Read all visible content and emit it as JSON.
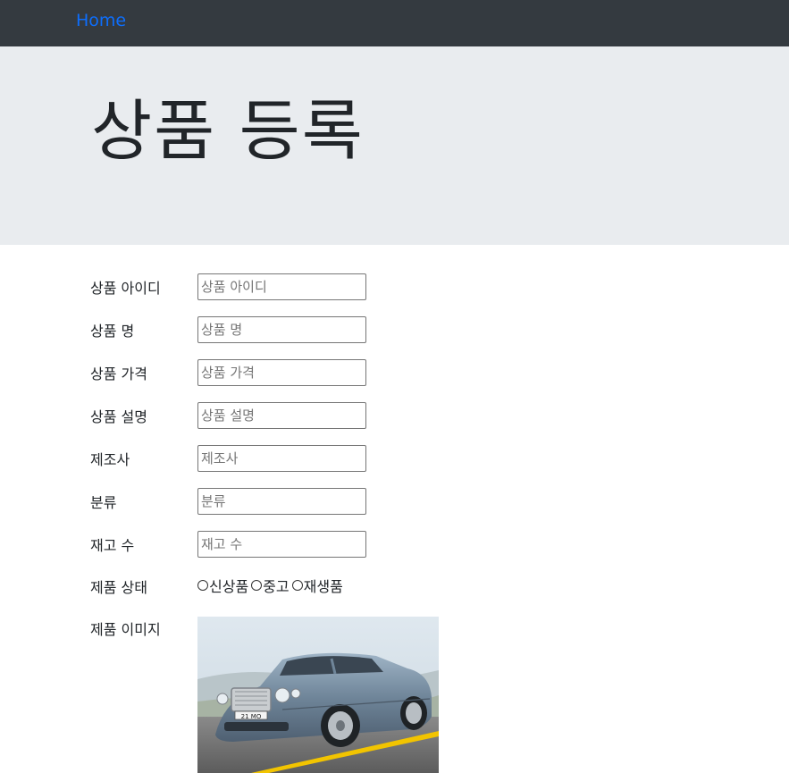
{
  "nav": {
    "home_label": "Home"
  },
  "page": {
    "title": "상품 등록"
  },
  "form": {
    "fields": [
      {
        "label": "상품 아이디",
        "placeholder": "상품 아이디"
      },
      {
        "label": "상품 명",
        "placeholder": "상품 명"
      },
      {
        "label": "상품 가격",
        "placeholder": "상품 가격"
      },
      {
        "label": "상품 설명",
        "placeholder": "상품 설명"
      },
      {
        "label": "제조사",
        "placeholder": "제조사"
      },
      {
        "label": "분류",
        "placeholder": "분류"
      },
      {
        "label": "재고 수",
        "placeholder": "재고 수"
      }
    ],
    "condition": {
      "label": "제품 상태",
      "options": [
        "신상품",
        "중고",
        "재생품"
      ]
    },
    "image": {
      "label": "제품 이미지",
      "plate_text": "21 MO"
    }
  },
  "colors": {
    "navbar": "#343a40",
    "link": "#0d6efd",
    "jumbotron": "#e9ecef"
  }
}
